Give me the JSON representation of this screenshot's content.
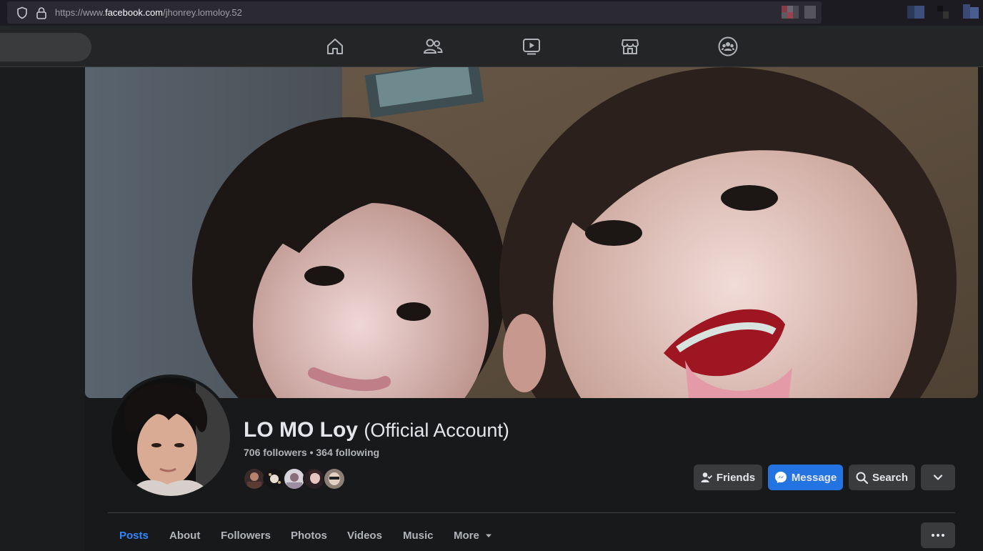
{
  "browser": {
    "url_prefix": "https://www.",
    "url_domain": "facebook.com",
    "url_path": "/jhonrey.lomoloy.52"
  },
  "nav": {
    "icons": [
      "home-icon",
      "friends-icon",
      "watch-icon",
      "marketplace-icon",
      "groups-icon"
    ]
  },
  "profile": {
    "name": "LO MO Loy",
    "name_suffix": "(Official Account)",
    "counts": "706 followers • 364 following"
  },
  "actions": {
    "friends": "Friends",
    "message": "Message",
    "search": "Search"
  },
  "tabs": {
    "posts": "Posts",
    "about": "About",
    "followers": "Followers",
    "photos": "Photos",
    "videos": "Videos",
    "music": "Music",
    "more": "More"
  },
  "colors": {
    "accent": "#2d88ff",
    "primary_button": "#2374e1",
    "background": "#18191a",
    "surface": "#242526"
  }
}
